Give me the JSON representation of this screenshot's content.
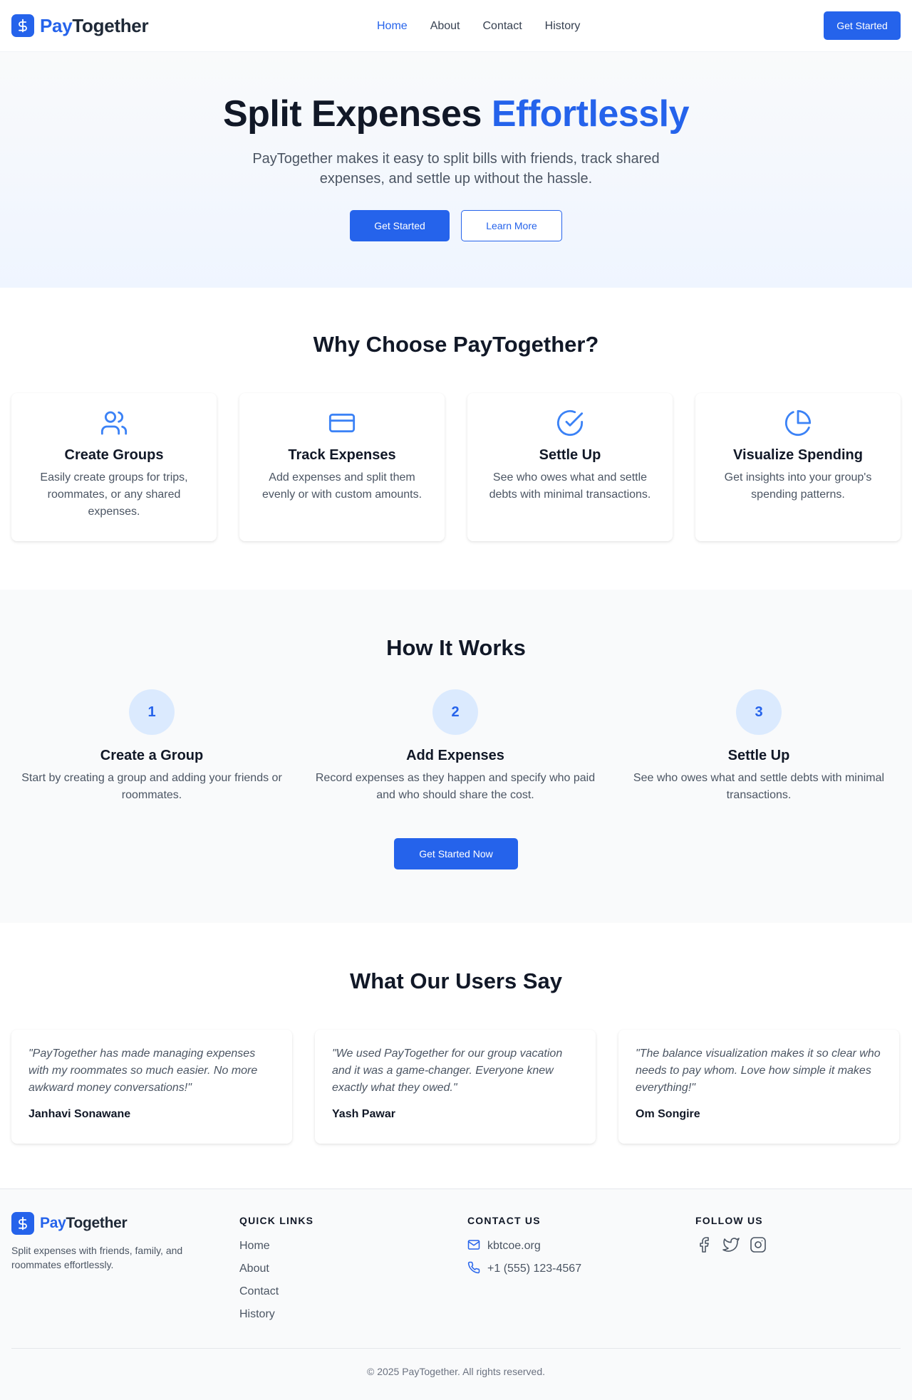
{
  "brand": {
    "part1": "Pay",
    "part2": "Together"
  },
  "nav": {
    "items": [
      {
        "label": "Home",
        "active": true
      },
      {
        "label": "About"
      },
      {
        "label": "Contact"
      },
      {
        "label": "History"
      }
    ],
    "cta": "Get Started"
  },
  "hero": {
    "title_main": "Split Expenses ",
    "title_accent": "Effortlessly",
    "subtitle": "PayTogether makes it easy to split bills with friends, track shared expenses, and settle up without the hassle.",
    "primary": "Get Started",
    "secondary": "Learn More"
  },
  "features": {
    "title": "Why Choose PayTogether?",
    "items": [
      {
        "icon": "users-icon",
        "title": "Create Groups",
        "text": "Easily create groups for trips, roommates, or any shared expenses."
      },
      {
        "icon": "credit-card-icon",
        "title": "Track Expenses",
        "text": "Add expenses and split them evenly or with custom amounts."
      },
      {
        "icon": "check-circle-icon",
        "title": "Settle Up",
        "text": "See who owes what and settle debts with minimal transactions."
      },
      {
        "icon": "pie-chart-icon",
        "title": "Visualize Spending",
        "text": "Get insights into your group's spending patterns."
      }
    ]
  },
  "how": {
    "title": "How It Works",
    "steps": [
      {
        "num": "1",
        "title": "Create a Group",
        "text": "Start by creating a group and adding your friends or roommates."
      },
      {
        "num": "2",
        "title": "Add Expenses",
        "text": "Record expenses as they happen and specify who paid and who should share the cost."
      },
      {
        "num": "3",
        "title": "Settle Up",
        "text": "See who owes what and settle debts with minimal transactions."
      }
    ],
    "cta": "Get Started Now"
  },
  "testimonials": {
    "title": "What Our Users Say",
    "items": [
      {
        "quote": "\"PayTogether has made managing expenses with my roommates so much easier. No more awkward money conversations!\"",
        "author": "Janhavi Sonawane"
      },
      {
        "quote": "\"We used PayTogether for our group vacation and it was a game-changer. Everyone knew exactly what they owed.\"",
        "author": "Yash Pawar"
      },
      {
        "quote": "\"The balance visualization makes it so clear who needs to pay whom. Love how simple it makes everything!\"",
        "author": "Om Songire"
      }
    ]
  },
  "footer": {
    "desc": "Split expenses with friends, family, and roommates effortlessly.",
    "quick_links_title": "QUICK LINKS",
    "quick_links": [
      "Home",
      "About",
      "Contact",
      "History"
    ],
    "contact_title": "CONTACT US",
    "email": "kbtcoe.org",
    "phone": "+1 (555) 123-4567",
    "follow_title": "FOLLOW US",
    "social": [
      "facebook-icon",
      "twitter-icon",
      "instagram-icon"
    ],
    "copyright": "© 2025 PayTogether. All rights reserved."
  },
  "colors": {
    "accent": "#2563eb",
    "accent_light": "#dbeafe",
    "text": "#111827",
    "muted": "#4b5563"
  }
}
